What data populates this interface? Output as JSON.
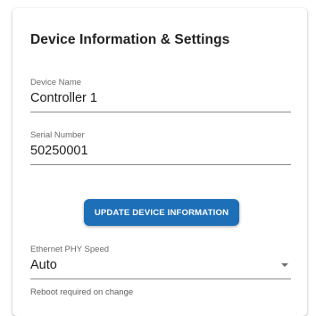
{
  "card": {
    "title": "Device Information & Settings"
  },
  "device_name": {
    "label": "Device Name",
    "value": "Controller 1"
  },
  "serial_number": {
    "label": "Serial Number",
    "value": "50250001"
  },
  "update_button": {
    "label": "UPDATE DEVICE INFORMATION"
  },
  "ethernet_speed": {
    "label": "Ethernet PHY Speed",
    "selected": "Auto",
    "icon": "chevron-down-icon",
    "helper": "Reboot required on change"
  },
  "colors": {
    "accent": "#1d6fb8",
    "text": "#1e1e1e",
    "label": "#6b6b6b",
    "underline": "#8a8a8a"
  }
}
